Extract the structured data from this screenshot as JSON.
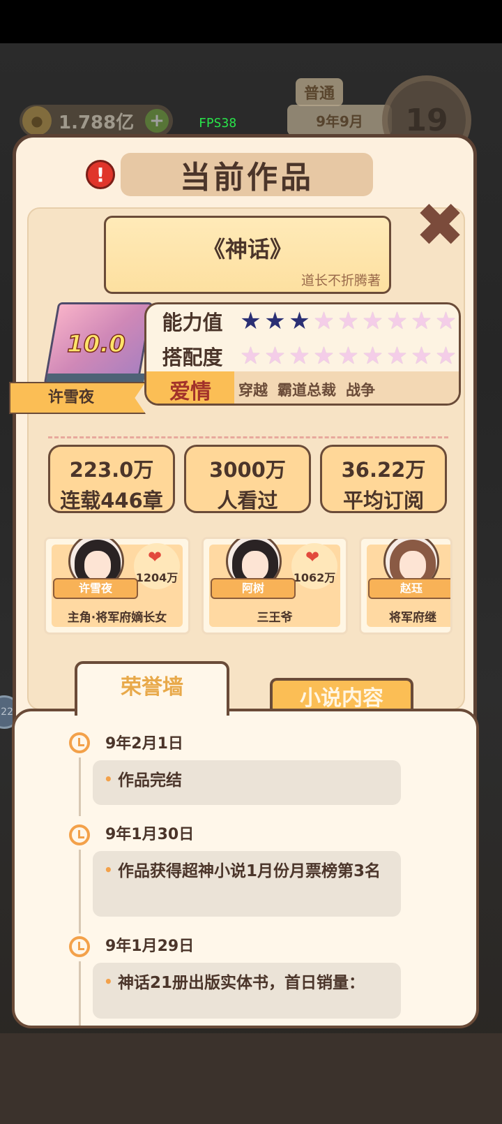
{
  "hud": {
    "coins": "1.788亿",
    "fps": "FPS38",
    "difficulty": "普通",
    "date": "9年9月",
    "day": "19"
  },
  "side_bubble": "22",
  "modal": {
    "title": "当前作品",
    "book_title": "《神话》",
    "author": "道长不折腾著",
    "score": "10.0",
    "protagonist": "许雪夜",
    "ability_label": "能力值",
    "ability_stars": 3,
    "match_label": "搭配度",
    "match_stars": 0,
    "star_total": 9,
    "main_genre": "爱情",
    "sub_genres": [
      "穿越",
      "霸道总裁",
      "战争"
    ],
    "stats": [
      {
        "value": "223.0万",
        "label": "连载446章"
      },
      {
        "value": "3000万",
        "label": "人看过"
      },
      {
        "value": "36.22万",
        "label": "平均订阅"
      }
    ],
    "characters": [
      {
        "name": "许雪夜",
        "likes": "1204万",
        "role": "主角·将军府嫡长女"
      },
      {
        "name": "阿树",
        "likes": "1062万",
        "role": "三王爷"
      },
      {
        "name": "赵珏",
        "likes": "",
        "role": "将军府继"
      }
    ],
    "tabs": {
      "active": "荣誉墙",
      "inactive": "小说内容"
    },
    "timeline": [
      {
        "date": "9年2月1日",
        "text": "作品完结"
      },
      {
        "date": "9年1月30日",
        "text": "作品获得超神小说1月份月票榜第3名"
      },
      {
        "date": "9年1月29日",
        "text": "神话21册出版实体书，首日销量："
      }
    ]
  },
  "colors": {
    "accent": "#fbbe55",
    "border": "#6a4b38",
    "panel": "#fdf0de",
    "star_on": "#2a2f74",
    "star_off": "#f4cde8"
  }
}
